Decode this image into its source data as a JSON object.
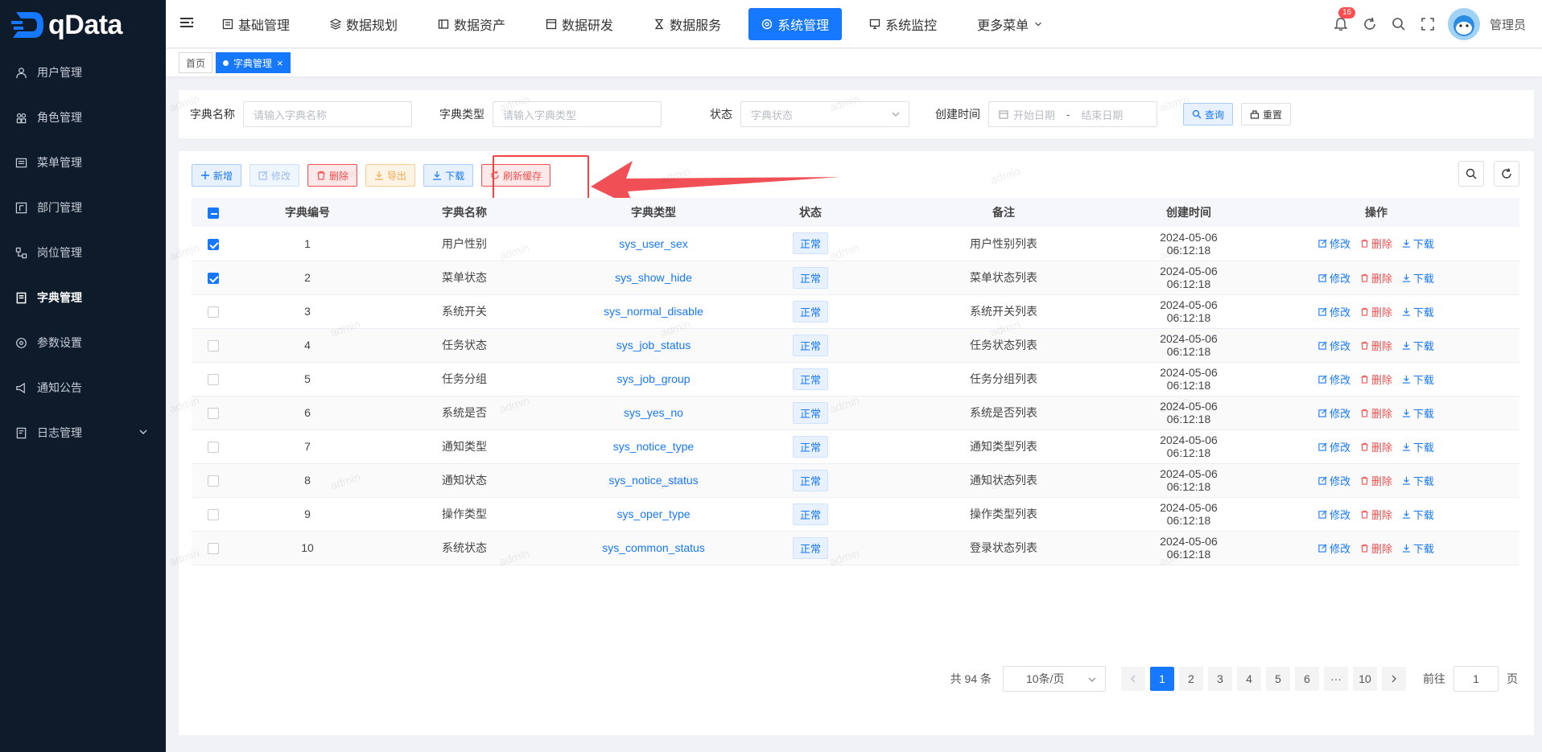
{
  "app": {
    "logo_text": "qData"
  },
  "sidebar": {
    "items": [
      {
        "label": "用户管理",
        "icon": "user-icon"
      },
      {
        "label": "角色管理",
        "icon": "role-icon"
      },
      {
        "label": "菜单管理",
        "icon": "menu-list-icon"
      },
      {
        "label": "部门管理",
        "icon": "department-icon"
      },
      {
        "label": "岗位管理",
        "icon": "post-icon"
      },
      {
        "label": "字典管理",
        "icon": "dictionary-icon",
        "active": true
      },
      {
        "label": "参数设置",
        "icon": "settings-icon"
      },
      {
        "label": "通知公告",
        "icon": "megaphone-icon"
      },
      {
        "label": "日志管理",
        "icon": "log-icon",
        "has_children": true
      }
    ]
  },
  "topnav": {
    "items": [
      {
        "label": "基础管理",
        "icon": "base-icon"
      },
      {
        "label": "数据规划",
        "icon": "layers-icon"
      },
      {
        "label": "数据资产",
        "icon": "asset-icon"
      },
      {
        "label": "数据研发",
        "icon": "dev-icon"
      },
      {
        "label": "数据服务",
        "icon": "hourglass-icon"
      },
      {
        "label": "系统管理",
        "icon": "system-icon",
        "active": true
      },
      {
        "label": "系统监控",
        "icon": "monitor-icon"
      },
      {
        "label": "更多菜单",
        "icon": "chevron-down-icon"
      }
    ],
    "notification_count": "16",
    "username": "管理员"
  },
  "tags": [
    {
      "label": "首页",
      "active": false
    },
    {
      "label": "字典管理",
      "active": true
    }
  ],
  "search": {
    "name_label": "字典名称",
    "name_placeholder": "请输入字典名称",
    "type_label": "字典类型",
    "type_placeholder": "请输入字典类型",
    "status_label": "状态",
    "status_placeholder": "字典状态",
    "time_label": "创建时间",
    "start_placeholder": "开始日期",
    "range_sep": "-",
    "end_placeholder": "结束日期",
    "query_label": "查询",
    "reset_label": "重置"
  },
  "toolbar": {
    "add_label": "新增",
    "edit_label": "修改",
    "delete_label": "删除",
    "export_label": "导出",
    "download_label": "下载",
    "refresh_cache_label": "刷新缓存"
  },
  "table": {
    "headers": [
      "字典编号",
      "字典名称",
      "字典类型",
      "状态",
      "备注",
      "创建时间",
      "操作"
    ],
    "rows": [
      {
        "checked": true,
        "id": "1",
        "name": "用户性别",
        "type": "sys_user_sex",
        "status": "正常",
        "remark": "用户性别列表",
        "created": "2024-05-06 06:12:18"
      },
      {
        "checked": true,
        "id": "2",
        "name": "菜单状态",
        "type": "sys_show_hide",
        "status": "正常",
        "remark": "菜单状态列表",
        "created": "2024-05-06 06:12:18"
      },
      {
        "checked": false,
        "id": "3",
        "name": "系统开关",
        "type": "sys_normal_disable",
        "status": "正常",
        "remark": "系统开关列表",
        "created": "2024-05-06 06:12:18"
      },
      {
        "checked": false,
        "id": "4",
        "name": "任务状态",
        "type": "sys_job_status",
        "status": "正常",
        "remark": "任务状态列表",
        "created": "2024-05-06 06:12:18"
      },
      {
        "checked": false,
        "id": "5",
        "name": "任务分组",
        "type": "sys_job_group",
        "status": "正常",
        "remark": "任务分组列表",
        "created": "2024-05-06 06:12:18"
      },
      {
        "checked": false,
        "id": "6",
        "name": "系统是否",
        "type": "sys_yes_no",
        "status": "正常",
        "remark": "系统是否列表",
        "created": "2024-05-06 06:12:18"
      },
      {
        "checked": false,
        "id": "7",
        "name": "通知类型",
        "type": "sys_notice_type",
        "status": "正常",
        "remark": "通知类型列表",
        "created": "2024-05-06 06:12:18"
      },
      {
        "checked": false,
        "id": "8",
        "name": "通知状态",
        "type": "sys_notice_status",
        "status": "正常",
        "remark": "通知状态列表",
        "created": "2024-05-06 06:12:18"
      },
      {
        "checked": false,
        "id": "9",
        "name": "操作类型",
        "type": "sys_oper_type",
        "status": "正常",
        "remark": "操作类型列表",
        "created": "2024-05-06 06:12:18"
      },
      {
        "checked": false,
        "id": "10",
        "name": "系统状态",
        "type": "sys_common_status",
        "status": "正常",
        "remark": "登录状态列表",
        "created": "2024-05-06 06:12:18"
      }
    ],
    "op_edit": "修改",
    "op_delete": "删除",
    "op_download": "下载"
  },
  "pagination": {
    "total_text": "共 94 条",
    "page_size": "10条/页",
    "pages": [
      "1",
      "2",
      "3",
      "4",
      "5",
      "6",
      "···",
      "10"
    ],
    "current": "1",
    "goto_label": "前往",
    "goto_value": "1",
    "page_unit": "页"
  },
  "watermark": "admin",
  "colors": {
    "primary": "#1677ff",
    "sidebar_bg": "#0d1b2a",
    "danger": "#f5504f",
    "annotation": "#f04444"
  }
}
